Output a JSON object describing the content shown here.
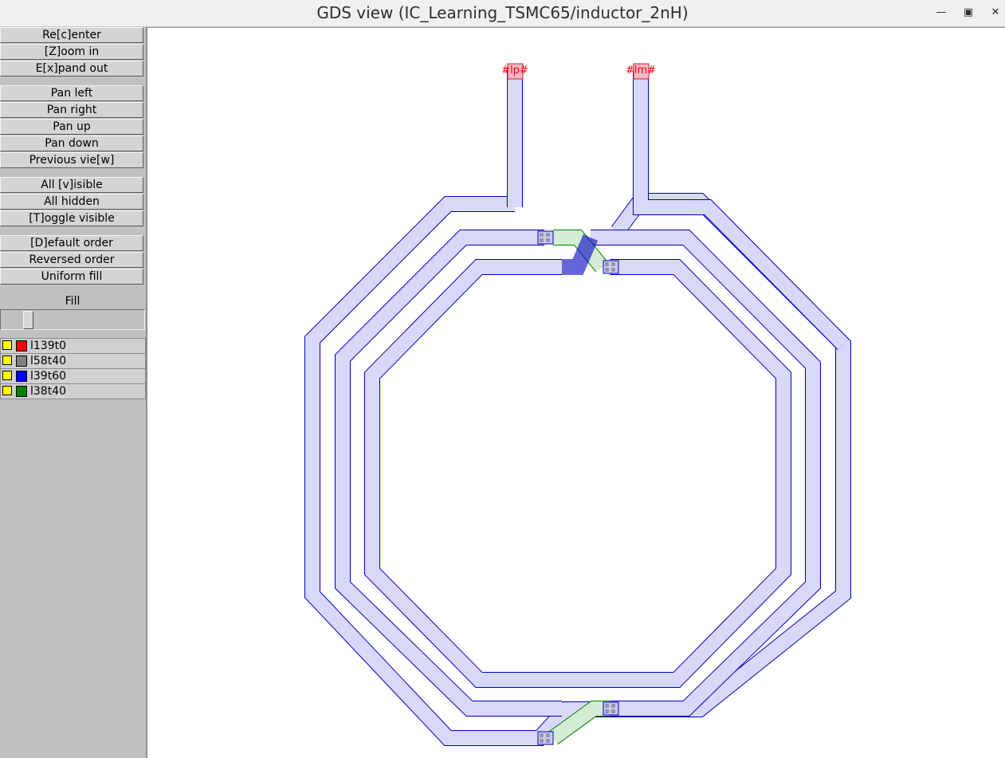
{
  "window": {
    "title": "GDS view (IC_Learning_TSMC65/inductor_2nH)",
    "controls": [
      "minimize-icon",
      "maximize-icon",
      "close-icon"
    ]
  },
  "sidebar": {
    "buttons": [
      {
        "label": "Re[c]enter"
      },
      {
        "label": "[Z]oom in"
      },
      {
        "label": "E[x]pand out"
      },
      {
        "label": "Pan left"
      },
      {
        "label": "Pan right"
      },
      {
        "label": "Pan up"
      },
      {
        "label": "Pan down"
      },
      {
        "label": "Previous vie[w]"
      },
      {
        "label": "All [v]isible"
      },
      {
        "label": "All hidden"
      },
      {
        "label": "[T]oggle visible"
      },
      {
        "label": "[D]efault order"
      },
      {
        "label": "Reversed order"
      },
      {
        "label": "Uniform fill"
      }
    ],
    "fill": {
      "label": "Fill",
      "value": 0.17
    },
    "layers": [
      {
        "name": "l139t0",
        "visible_color": "#ffff00",
        "color": "#ff0000"
      },
      {
        "name": "l58t40",
        "visible_color": "#ffff00",
        "color": "#808080"
      },
      {
        "name": "l39t60",
        "visible_color": "#ffff00",
        "color": "#0000ff"
      },
      {
        "name": "l38t40",
        "visible_color": "#ffff00",
        "color": "#008000"
      }
    ]
  },
  "layout": {
    "pin_labels": [
      "#lp#",
      "#lm#"
    ],
    "colors": {
      "metal_fill": "#d8d8f8",
      "metal_edge": "#0000c0",
      "underpass_fill": "#d4ecd4",
      "underpass_edge": "#008000",
      "pin_fill": "#f4b8c8",
      "pin_text": "#ff0000"
    }
  }
}
